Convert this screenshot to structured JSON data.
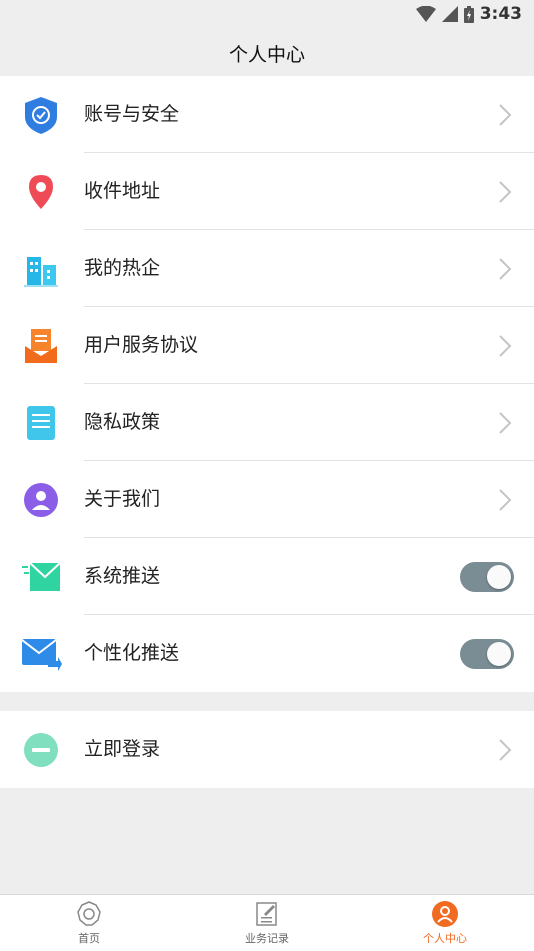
{
  "status_bar": {
    "time": "3:43"
  },
  "header": {
    "title": "个人中心"
  },
  "menu": [
    {
      "label": "账号与安全"
    },
    {
      "label": "收件地址"
    },
    {
      "label": "我的热企"
    },
    {
      "label": "用户服务协议"
    },
    {
      "label": "隐私政策"
    },
    {
      "label": "关于我们"
    }
  ],
  "toggles": [
    {
      "label": "系统推送",
      "on": true
    },
    {
      "label": "个性化推送",
      "on": true
    }
  ],
  "login": {
    "label": "立即登录"
  },
  "tabbar": {
    "tabs": [
      {
        "label": "首页"
      },
      {
        "label": "业务记录"
      },
      {
        "label": "个人中心",
        "active": true
      }
    ]
  },
  "colors": {
    "accent": "#f06a22",
    "toggle_track": "#7a8c94"
  }
}
